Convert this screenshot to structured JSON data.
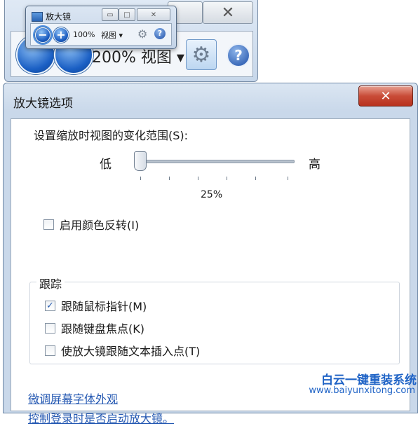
{
  "mini_window": {
    "title": "放大镜",
    "zoom_out": "−",
    "zoom_in": "+",
    "zoom_level": "100%",
    "view_label": "视图 ▾",
    "settings_icon": "gear-icon",
    "help_icon": "?"
  },
  "background_magnified": {
    "zoom_level": "200%",
    "view_label": "视图 ▾"
  },
  "dialog": {
    "title": "放大镜选项",
    "close_label": "✕",
    "range_label": "设置缩放时视图的变化范围(S):",
    "slider": {
      "low_label": "低",
      "high_label": "高",
      "value_text": "25%",
      "value_fraction": 0.0
    },
    "invert_colors": {
      "label": "启用颜色反转(I)",
      "checked": false
    },
    "tracking": {
      "group_title": "跟踪",
      "items": [
        {
          "label": "跟随鼠标指针(M)",
          "checked": true
        },
        {
          "label": "跟随键盘焦点(K)",
          "checked": false
        },
        {
          "label": "使放大镜跟随文本插入点(T)",
          "checked": false
        }
      ]
    },
    "links": [
      "微调屏幕字体外观",
      "控制登录时是否启动放大镜。"
    ]
  },
  "watermark": {
    "brand": "白云一键重装系统",
    "url": "www.baiyunxitong.com"
  }
}
